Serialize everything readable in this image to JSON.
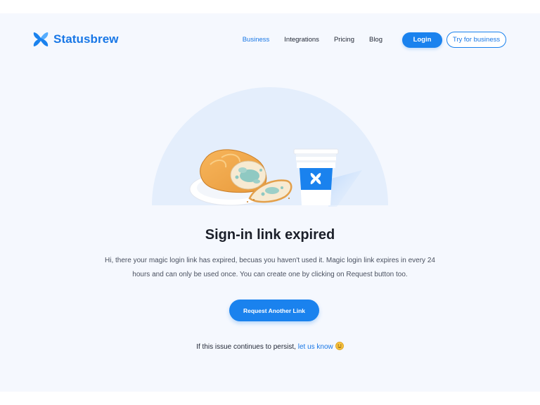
{
  "brand": {
    "name": "Statusbrew",
    "accent": "#1a82ee"
  },
  "nav": {
    "links": [
      "Business",
      "Integrations",
      "Pricing",
      "Blog"
    ],
    "login_label": "Login",
    "try_label": "Try for business"
  },
  "main": {
    "title": "Sign-in link expired",
    "description": "Hi, there your magic login link has expired, becuas you haven't used it. Magic login link expires in every 24 hours and can only be used once. You can create one by clicking on Request button too.",
    "button_label": "Request Another Link",
    "footer_prefix": "If this issue continues to persist, ",
    "footer_link": "let us know"
  },
  "icons": {
    "logo": "statusbrew-logo-icon",
    "illustration": "moldy-bread-and-coffee-cup-illustration",
    "emoji": "smiling-face-icon"
  }
}
